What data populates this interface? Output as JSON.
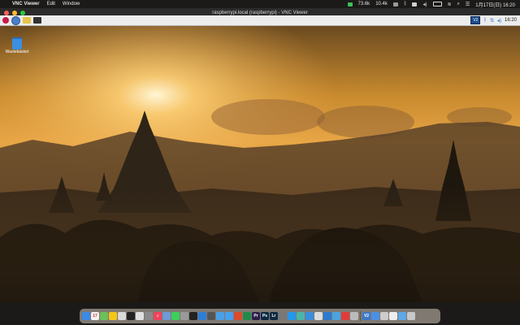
{
  "menubar": {
    "apple_glyph": "",
    "app_name": "VNC Viewer",
    "menus": [
      "Edit",
      "Window"
    ],
    "status": {
      "stat1": "73.6k",
      "stat2": "10.4k",
      "datetime": "1月17日(日) 16:20"
    }
  },
  "window": {
    "title": "raspberrypi.local (raspberrypi) - VNC Viewer"
  },
  "taskbar": {
    "vnc_label": "V2",
    "clock": "16:20"
  },
  "desktop": {
    "trash_label": "Wastebasket"
  },
  "dock": {
    "items": [
      {
        "name": "finder",
        "color": "#3b8ae6",
        "label": ""
      },
      {
        "name": "calendar",
        "color": "#f2f2f2",
        "label": "17"
      },
      {
        "name": "maps",
        "color": "#6cbf5a",
        "label": ""
      },
      {
        "name": "stickies",
        "color": "#f5c518",
        "label": ""
      },
      {
        "name": "notes",
        "color": "#d9d9d9",
        "label": ""
      },
      {
        "name": "clock",
        "color": "#222222",
        "label": ""
      },
      {
        "name": "chrome",
        "color": "#e0e0e0",
        "label": ""
      },
      {
        "name": "calculator",
        "color": "#8a8a8a",
        "label": ""
      },
      {
        "name": "music",
        "color": "#f0435b",
        "label": "♫"
      },
      {
        "name": "preview",
        "color": "#6e9ad6",
        "label": ""
      },
      {
        "name": "messages",
        "color": "#3dcf5b",
        "label": ""
      },
      {
        "name": "facetime",
        "color": "#9a9a9a",
        "label": ""
      },
      {
        "name": "terminal",
        "color": "#222222",
        "label": ""
      },
      {
        "name": "xcode",
        "color": "#2e7ed6",
        "label": ""
      },
      {
        "name": "screenshot",
        "color": "#555555",
        "label": ""
      },
      {
        "name": "safari",
        "color": "#4aa0e8",
        "label": ""
      },
      {
        "name": "mail",
        "color": "#46a0f0",
        "label": ""
      },
      {
        "name": "photo-app",
        "color": "#d94b2b",
        "label": ""
      },
      {
        "name": "excel",
        "color": "#1f8a4c",
        "label": ""
      },
      {
        "name": "premiere",
        "color": "#2c1f4a",
        "label": "Pr"
      },
      {
        "name": "photoshop",
        "color": "#0b2844",
        "label": "Ps"
      },
      {
        "name": "lightroom",
        "color": "#0f2a40",
        "label": "Lr"
      },
      {
        "name": "app-a",
        "color": "#777777",
        "label": ""
      },
      {
        "name": "docker",
        "color": "#2496ed",
        "label": ""
      },
      {
        "name": "app-b",
        "color": "#49b6a8",
        "label": ""
      },
      {
        "name": "app-c",
        "color": "#3c8de0",
        "label": ""
      },
      {
        "name": "app-d",
        "color": "#dddddd",
        "label": ""
      },
      {
        "name": "vscode",
        "color": "#2a7ad2",
        "label": ""
      },
      {
        "name": "app-e",
        "color": "#4aa4e0",
        "label": ""
      },
      {
        "name": "app-f",
        "color": "#e23b3b",
        "label": ""
      },
      {
        "name": "app-g",
        "color": "#bbbbbb",
        "label": ""
      },
      {
        "name": "vnc-viewer",
        "color": "#3a78c8",
        "label": "V2"
      },
      {
        "name": "app-h",
        "color": "#4a90e2",
        "label": ""
      },
      {
        "name": "app-i",
        "color": "#cccccc",
        "label": ""
      },
      {
        "name": "app-j",
        "color": "#eeeeee",
        "label": ""
      },
      {
        "name": "folder",
        "color": "#5fa8e8",
        "label": ""
      },
      {
        "name": "trash",
        "color": "#c8c8c8",
        "label": ""
      }
    ]
  }
}
